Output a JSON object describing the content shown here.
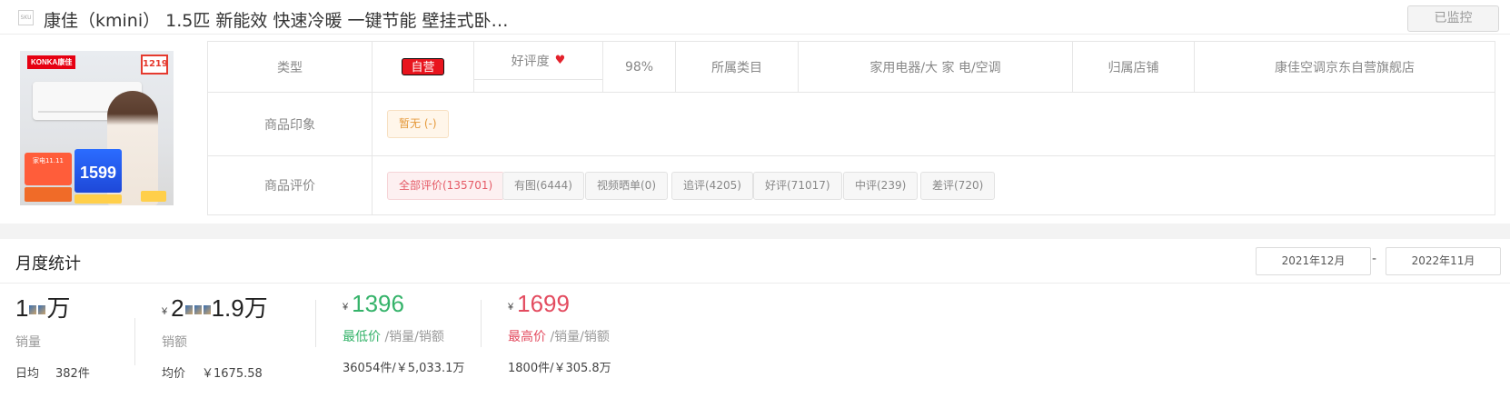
{
  "header": {
    "sku_icon_text": "SKU",
    "title": "康佳（kmini） 1.5匹 新能效 快速冷暖 一键节能 壁挂式卧…",
    "monitor_button": "已监控"
  },
  "product_image": {
    "brand": "KONKA康佳",
    "price_tag": "1219",
    "promo_price": "1599",
    "promo_text": "家电11.11"
  },
  "info": {
    "type_label": "类型",
    "type_value": "自营",
    "rating_label": "好评度",
    "rating_value": "98%",
    "category_label": "所属类目",
    "category_value": "家用电器/大 家 电/空调",
    "shop_label": "归属店铺",
    "shop_value": "康佳空调京东自营旗舰店",
    "impression_label": "商品印象",
    "impression_value": "暂无  (-)",
    "review_label": "商品评价",
    "review_chips": [
      "全部评价(135701)",
      "有图(6444)",
      "视频晒单(0)",
      "追评(4205)",
      "好评(71017)",
      "中评(239)",
      "差评(720)"
    ]
  },
  "stats": {
    "title": "月度统计",
    "date_start": "2021年12月",
    "date_sep": "-",
    "date_end": "2022年11月",
    "sales": {
      "value_a": "1",
      "value_b": "万",
      "label": "销量",
      "daily_label": "日均",
      "daily_value": "382件"
    },
    "revenue": {
      "yen": "¥",
      "value_a": "2",
      "value_b": "1.9万",
      "label": "销额",
      "avg_label": "均价",
      "avg_value": "￥1675.58"
    },
    "min_price": {
      "yen": "¥",
      "value": "1396",
      "label_main": "最低价",
      "label_rest": " /销量/销额",
      "detail": "36054件/￥5,033.1万"
    },
    "max_price": {
      "yen": "¥",
      "value": "1699",
      "label_main": "最高价",
      "label_rest": " /销量/销额",
      "detail": "1800件/￥305.8万"
    }
  }
}
